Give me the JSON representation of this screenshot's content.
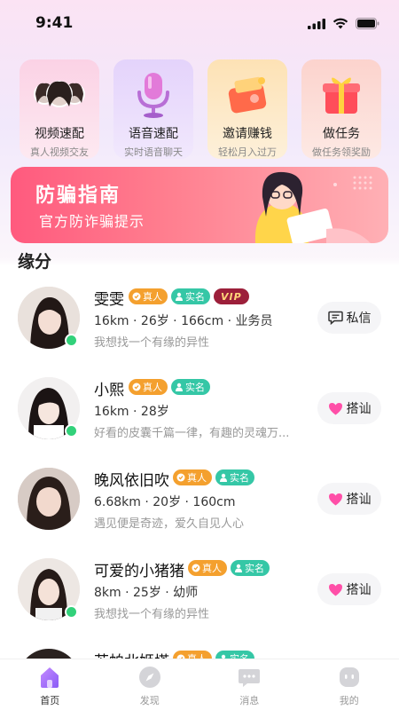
{
  "status_bar": {
    "time": "9:41"
  },
  "features": [
    {
      "title": "视频速配",
      "subtitle": "真人视频交友",
      "icon": "video-match-avatars"
    },
    {
      "title": "语音速配",
      "subtitle": "实时语音聊天",
      "icon": "microphone-icon"
    },
    {
      "title": "邀请赚钱",
      "subtitle": "轻松月入过万",
      "icon": "wallet-icon"
    },
    {
      "title": "做任务",
      "subtitle": "做任务领奖励",
      "icon": "gift-box-icon"
    }
  ],
  "banner": {
    "title": "防骗指南",
    "subtitle": "官方防诈骗提示"
  },
  "section": {
    "title": "缘分"
  },
  "badges": {
    "real": "真人",
    "verified": "实名",
    "vip": "VIP"
  },
  "users": [
    {
      "name": "雯雯",
      "info": "16km · 26岁 · 166cm · 业务员",
      "bio": "我想找一个有缘的异性",
      "action": "私信",
      "vip": true,
      "online": true
    },
    {
      "name": "小熙",
      "info": "16km · 28岁",
      "bio": "好看的皮囊千篇一律，有趣的灵魂万...",
      "action": "搭讪",
      "vip": false,
      "online": true
    },
    {
      "name": "晚风依旧吹",
      "info": "6.68km · 20岁 · 160cm",
      "bio": "遇见便是奇迹，爱久自见人心",
      "action": "搭讪",
      "vip": false,
      "online": false
    },
    {
      "name": "可爱的小猪猪",
      "info": "8km · 25岁 · 幼师",
      "bio": "我想找一个有缘的异性",
      "action": "搭讪",
      "vip": false,
      "online": true
    },
    {
      "name": "苏帕北姬塔",
      "info": "",
      "bio": "",
      "action": "",
      "vip": false,
      "online": false
    }
  ],
  "tabs": [
    {
      "label": "首页",
      "icon": "home-icon",
      "active": true
    },
    {
      "label": "发现",
      "icon": "compass-icon",
      "active": false
    },
    {
      "label": "消息",
      "icon": "message-icon",
      "active": false
    },
    {
      "label": "我的",
      "icon": "profile-icon",
      "active": false
    }
  ],
  "colors": {
    "accent": "#a86cf3",
    "banner": "#ff5a7e",
    "online": "#32d17a",
    "heart": "#ff4fa8"
  }
}
